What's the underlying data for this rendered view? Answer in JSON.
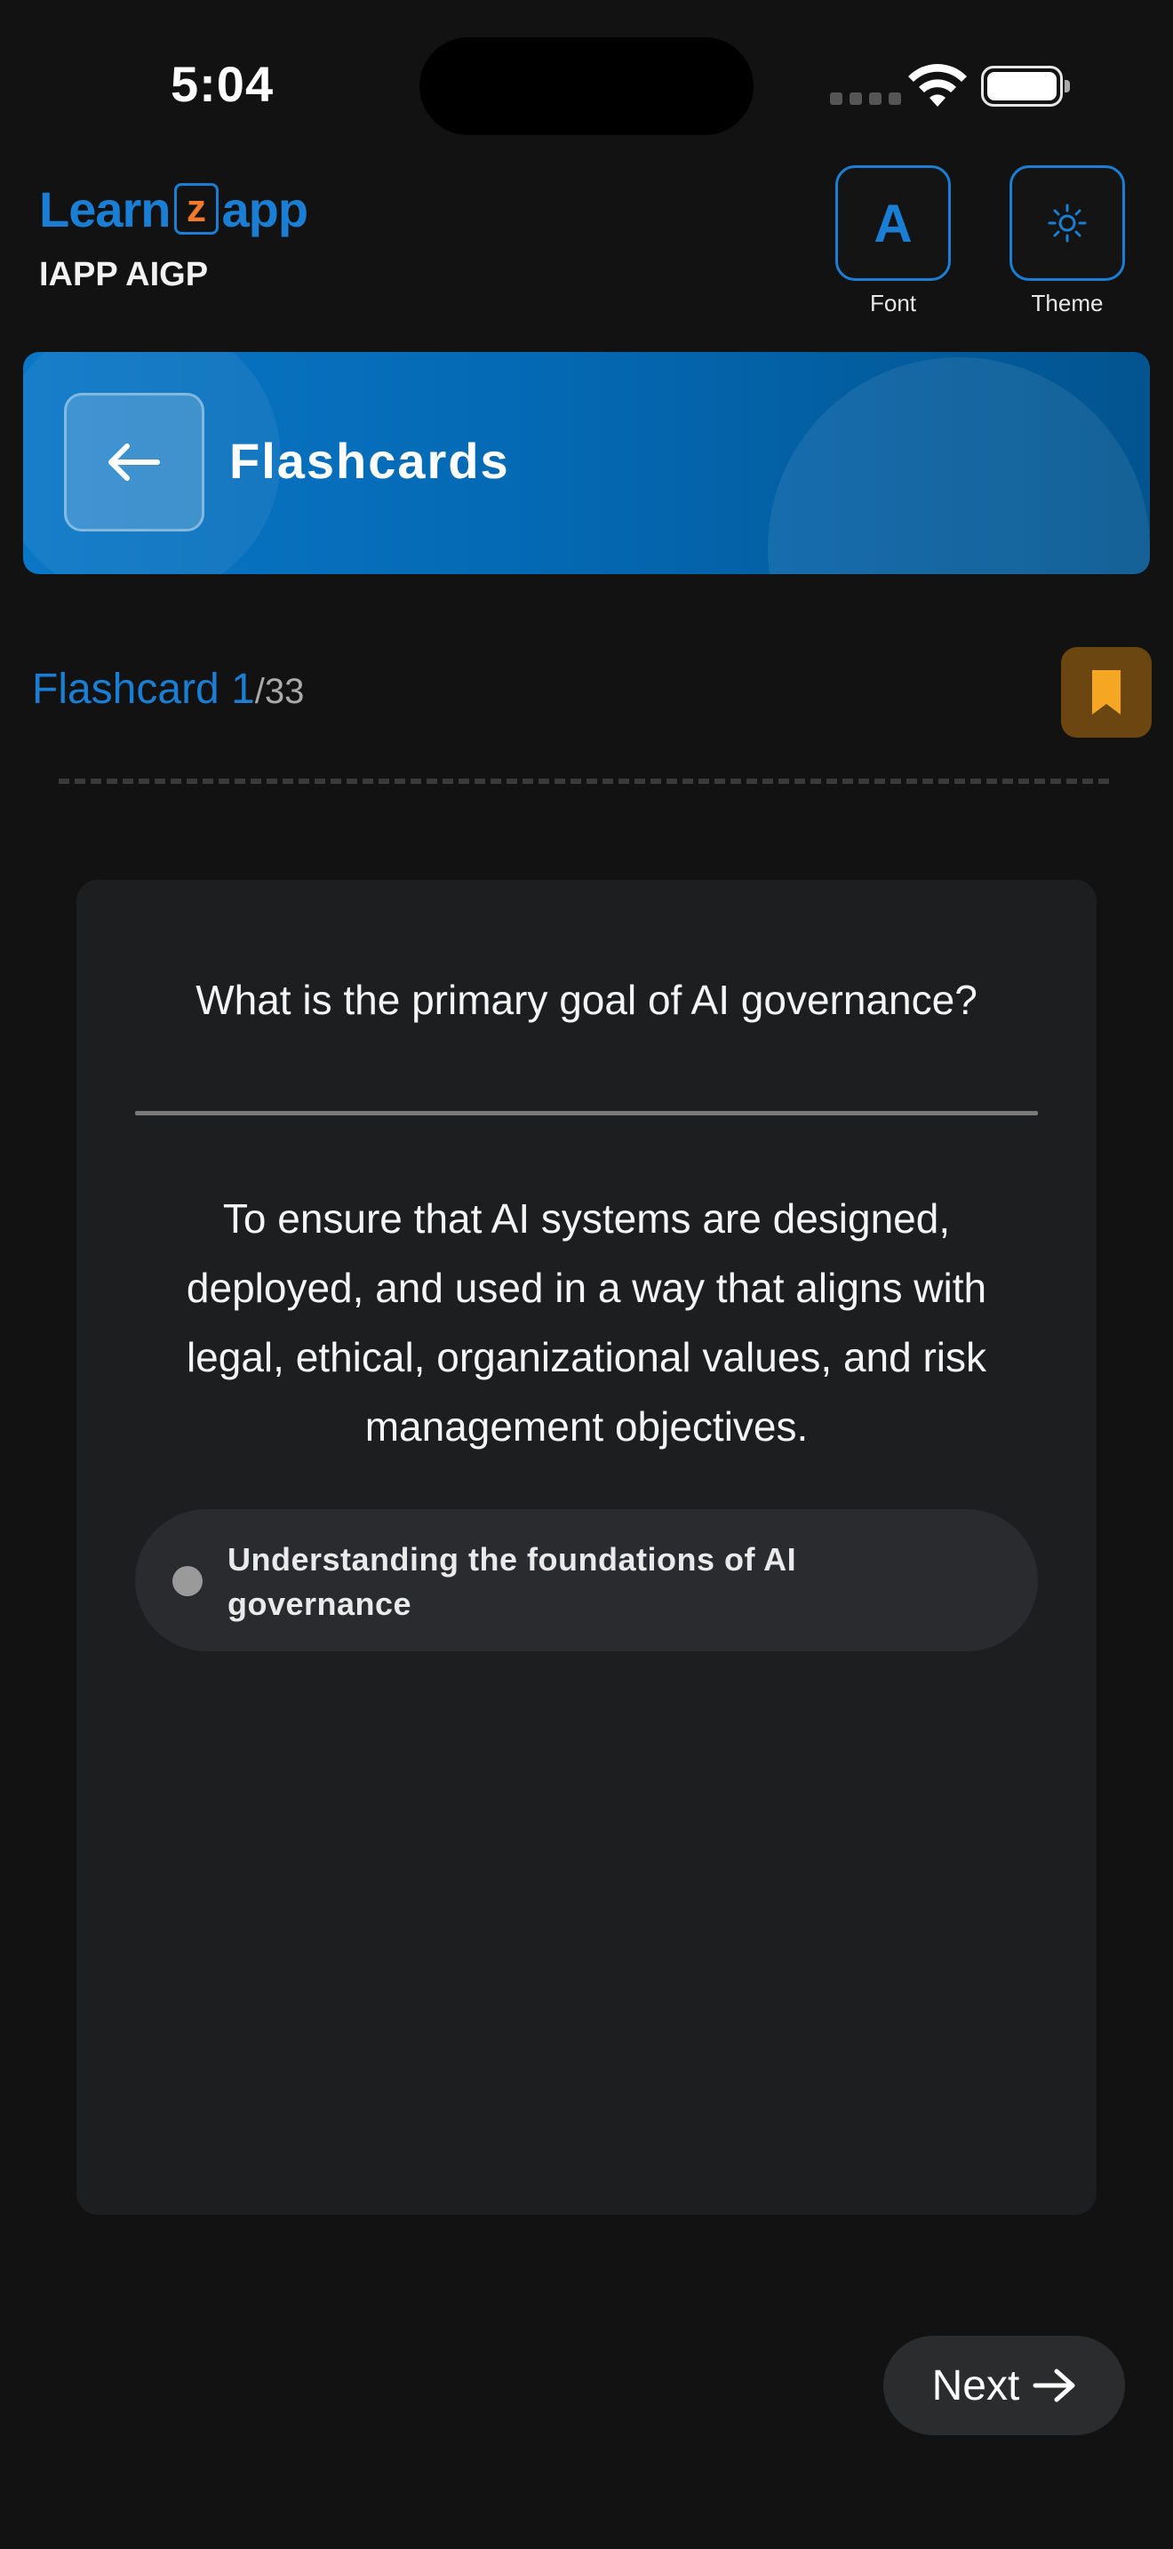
{
  "status_bar": {
    "time": "5:04"
  },
  "header": {
    "logo_parts": {
      "before": "Learn",
      "z": "z",
      "after": "app"
    },
    "subtitle": "IAPP AIGP",
    "font_label": "Font",
    "theme_label": "Theme",
    "font_glyph": "A"
  },
  "banner": {
    "title": "Flashcards"
  },
  "progress": {
    "current_label": "Flashcard 1",
    "total_label": "/33"
  },
  "card": {
    "question": "What is the primary goal of AI governance?",
    "answer": "To ensure that AI systems are designed, deployed, and used in a way that aligns with legal, ethical, organizational values, and risk management objectives.",
    "topic": "Understanding the foundations of AI governance"
  },
  "next_label": "Next",
  "colors": {
    "accent": "#1a7fd4",
    "logo_z": "#f07a2a",
    "bookmark": "#f5a623",
    "background": "#121212",
    "card": "#1d1e20"
  },
  "icons": {
    "back": "arrow-left-icon",
    "next": "arrow-right-icon",
    "bookmark": "bookmark-icon",
    "theme": "sun-icon",
    "font": "font-a-icon"
  }
}
